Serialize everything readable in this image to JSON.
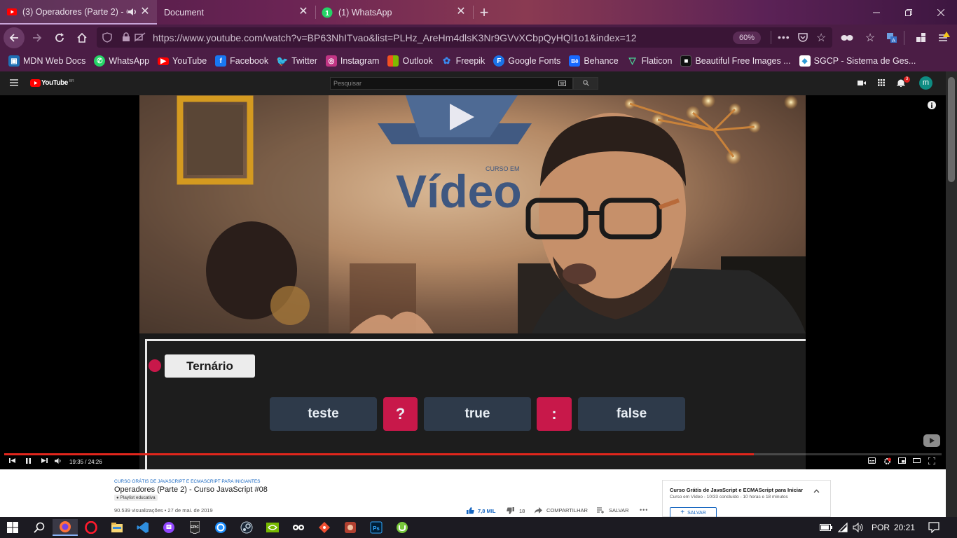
{
  "tabs": [
    {
      "title": "(3) Operadores (Parte 2) - Cu",
      "favicon": "youtube-icon",
      "active": true,
      "audio": true
    },
    {
      "title": "Document",
      "favicon": "none",
      "active": false
    },
    {
      "title": "(1) WhatsApp",
      "favicon": "whatsapp-icon",
      "active": false
    }
  ],
  "navbar": {
    "url": "https://www.youtube.com/watch?v=BP63NhITvao&list=PLHz_AreHm4dlsK3Nr9GVvXCbpQyHQl1o1&index=12",
    "zoom": "60%"
  },
  "bookmarks": [
    {
      "label": "MDN Web Docs",
      "icon": "mdn-icon",
      "color": "#1f6fb4"
    },
    {
      "label": "WhatsApp",
      "icon": "whatsapp-icon",
      "color": "#25d366"
    },
    {
      "label": "YouTube",
      "icon": "youtube-icon",
      "color": "#ff0000"
    },
    {
      "label": "Facebook",
      "icon": "facebook-icon",
      "color": "#1877f2"
    },
    {
      "label": "Twitter",
      "icon": "twitter-icon",
      "color": "#1da1f2"
    },
    {
      "label": "Instagram",
      "icon": "instagram-icon",
      "color": "#c13584"
    },
    {
      "label": "Outlook",
      "icon": "outlook-icon",
      "color": "#f25022"
    },
    {
      "label": "Freepik",
      "icon": "freepik-icon",
      "color": "#1273eb"
    },
    {
      "label": "Google Fonts",
      "icon": "google-fonts-icon",
      "color": "#1a73e8"
    },
    {
      "label": "Behance",
      "icon": "behance-icon",
      "color": "#1769ff"
    },
    {
      "label": "Flaticon",
      "icon": "flaticon-icon",
      "color": "#4ad295"
    },
    {
      "label": "Beautiful Free Images ...",
      "icon": "unsplash-icon",
      "color": "#111111"
    },
    {
      "label": "SGCP - Sistema de Ges...",
      "icon": "sgcp-icon",
      "color": "#2e9bd6"
    }
  ],
  "youtube": {
    "logo": "YouTube",
    "region": "BR",
    "search_placeholder": "Pesquisar",
    "notifications": "3",
    "avatar_letter": "m"
  },
  "video": {
    "background_text": "Vídeo",
    "background_subtext": "CURSO EM",
    "slide_title": "Ternário",
    "tokens": [
      "teste",
      "?",
      "true",
      ":",
      "false"
    ],
    "time": "19:35 / 24:26",
    "progress": 0.8
  },
  "details": {
    "playlist_label": "CURSO GRÁTIS DE JAVASCRIPT E ECMASCRIPT PARA INICIANTES",
    "title": "Operadores (Parte 2) - Curso JavaScript #08",
    "playlist_chip": "Playlist educativa",
    "views": "90.539 visualizações • 27 de mai. de 2019",
    "likes": "7,8 MIL",
    "dislikes": "18",
    "share": "COMPARTILHAR",
    "save": "SALVAR"
  },
  "playlist_box": {
    "title": "Curso Grátis de JavaScript e ECMAScript para Iniciar",
    "meta": "Curso em Vídeo - 10/33 concluído - 10 horas e 18 minutos",
    "save": "SALVAR"
  },
  "taskbar": {
    "lang": "POR",
    "time": "20:21"
  }
}
